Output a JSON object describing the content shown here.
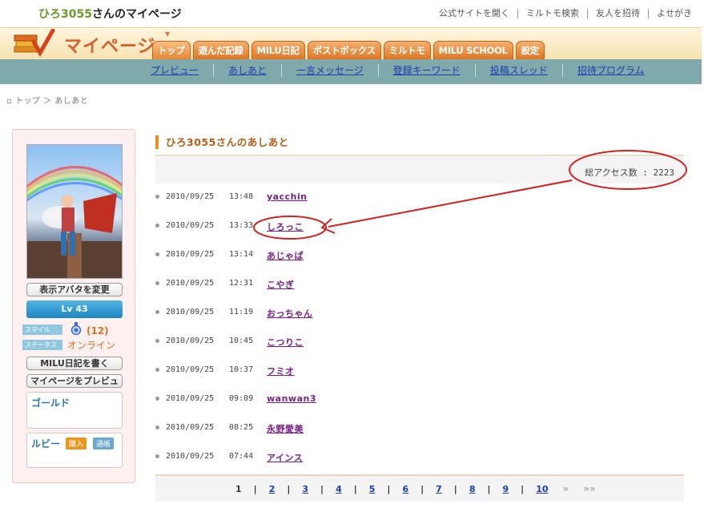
{
  "page_title": {
    "username": "ひろ3055",
    "suffix": "さんのマイページ"
  },
  "top_links": [
    "公式サイトを開く",
    "ミルトモ検索",
    "友人を招待",
    "よせがき"
  ],
  "logo_text": "マイページ",
  "tabs": [
    "トップ",
    "遊んだ記録",
    "MILU日記",
    "ポストボックス",
    "ミルトモ",
    "MILU SCHOOL",
    "設定"
  ],
  "subnav": [
    "プレビュー",
    "あしあと",
    "一言メッセージ",
    "登録キーワード",
    "投稿スレッド",
    "招待プログラム"
  ],
  "breadcrumb": "▫ トップ ＞ あしあと",
  "sidebar": {
    "change_avatar": "表示アバタを変更",
    "level": "Lv 43",
    "smile_label": "スマイル",
    "status_label": "ステータス",
    "smile_count": "(12)",
    "status_value": "オンライン",
    "write_diary": "MILU日記を書く",
    "preview": "マイページをプレビュー",
    "gold_title": "ゴールド",
    "ruby_title": "ルビー",
    "buy": "購入",
    "bank": "通帳"
  },
  "main": {
    "heading": "ひろ3055さんのあしあと",
    "total_access": "総アクセス数 : 2223",
    "visits": [
      {
        "date": "2010/09/25",
        "time": "13:48",
        "name": "yacchin"
      },
      {
        "date": "2010/09/25",
        "time": "13:33",
        "name": "しろっこ"
      },
      {
        "date": "2010/09/25",
        "time": "13:14",
        "name": "あじゃぱ"
      },
      {
        "date": "2010/09/25",
        "time": "12:31",
        "name": "こやぎ"
      },
      {
        "date": "2010/09/25",
        "time": "11:19",
        "name": "おっちゃん"
      },
      {
        "date": "2010/09/25",
        "time": "10:45",
        "name": "こつりこ"
      },
      {
        "date": "2010/09/25",
        "time": "10:37",
        "name": "フミオ"
      },
      {
        "date": "2010/09/25",
        "time": "09:09",
        "name": "wanwan3"
      },
      {
        "date": "2010/09/25",
        "time": "08:25",
        "name": "永野愛美"
      },
      {
        "date": "2010/09/25",
        "time": "07:44",
        "name": "アインス"
      }
    ],
    "pages": [
      "1",
      "2",
      "3",
      "4",
      "5",
      "6",
      "7",
      "8",
      "9",
      "10"
    ],
    "current_page": "1",
    "next": "»",
    "last": "»»"
  },
  "colors": {
    "accent": "#e8901e",
    "link": "#1b3cb0",
    "visitor_link": "#7a1e8a",
    "subnav": "#7fa9ab",
    "annotation": "#d42020"
  }
}
